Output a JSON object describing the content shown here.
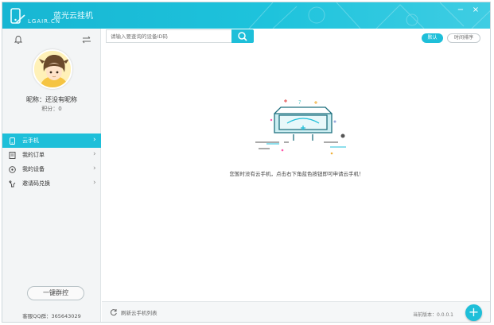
{
  "app": {
    "logo_cn": "蓝光云挂机",
    "logo_en": "LGAIR.CN"
  },
  "window": {
    "minimize": "−",
    "close": "×"
  },
  "sidebar": {
    "nickname": "昵称：还没有昵称",
    "points": "积分：0",
    "items": [
      {
        "label": "云手机",
        "icon": "phone-icon",
        "active": true
      },
      {
        "label": "我的订单",
        "icon": "order-icon",
        "active": false
      },
      {
        "label": "我的设备",
        "icon": "device-icon",
        "active": false
      },
      {
        "label": "邀请码兑换",
        "icon": "gift-icon",
        "active": false
      }
    ],
    "chevron": "›",
    "bulk_button": "一键群控",
    "qq": "客服QQ群：365643029"
  },
  "search": {
    "placeholder": "请输入要查询的设备ID码"
  },
  "sort": {
    "default_label": "默认",
    "time_label": "时间排序"
  },
  "main": {
    "empty_message": "您暂时没有云手机，点击右下角蓝色按钮即可申请云手机！"
  },
  "footer": {
    "refresh_label": "刷新云手机列表",
    "version": "当前版本：0.0.0.1",
    "add": "+"
  },
  "colors": {
    "accent": "#1ebfd9",
    "titlebar": "#17b6d3"
  }
}
